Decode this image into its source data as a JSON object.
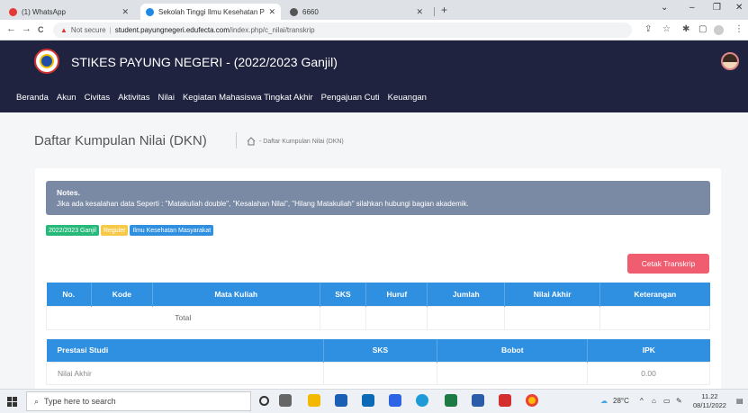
{
  "browser": {
    "tabs": [
      {
        "title": "(1) WhatsApp",
        "color": "#e53935"
      },
      {
        "title": "Sekolah Tinggi Ilmu Kesehatan P",
        "color": "#1e88e5"
      },
      {
        "title": "6660",
        "color": "#555555"
      }
    ],
    "new_tab": "+",
    "nav": {
      "back": "←",
      "forward": "→",
      "reload": "C"
    },
    "url": {
      "warning": "▲",
      "not_secure": "Not secure",
      "sep": "|",
      "host": "student.payungnegeri.edufecta.com",
      "path": "/index.php/c_nilai/transkrip"
    },
    "window": {
      "dropdown": "⌄",
      "minimize": "–",
      "restore": "❐",
      "close": "✕"
    }
  },
  "site": {
    "title": "STIKES PAYUNG NEGERI - (2022/2023 Ganjil)",
    "menu": [
      "Beranda",
      "Akun",
      "Civitas",
      "Aktivitas",
      "Nilai",
      "Kegiatan Mahasiswa Tingkat Akhir",
      "Pengajuan Cuti",
      "Keuangan"
    ]
  },
  "page": {
    "title": "Daftar Kumpulan Nilai (DKN)",
    "breadcrumb": "- Daftar Kumpulan Nilai (DKN)"
  },
  "notes": {
    "title": "Notes.",
    "message": "Jika ada kesalahan data Seperti : \"Matakuliah double\", \"Kesalahan Nilai\", \"Hilang Matakuliah\" silahkan hubungi bagian akademik."
  },
  "badges": [
    {
      "label": "2022/2023 Ganjil",
      "color": "#27b97a"
    },
    {
      "label": "Reguler",
      "color": "#f7c948"
    },
    {
      "label": "Ilmu Kesehatan Masyarakat",
      "color": "#2f8fe0"
    }
  ],
  "print_button": "Cetak Transkrip",
  "transcript_table": {
    "headers": [
      "No.",
      "Kode",
      "Mata Kuliah",
      "SKS",
      "Huruf",
      "Jumlah",
      "Nilai Akhir",
      "Keterangan"
    ],
    "total_label": "Total"
  },
  "summary_table": {
    "headers": [
      "Prestasi Studi",
      "SKS",
      "Bobot",
      "IPK"
    ],
    "row": {
      "label": "Nilai Akhir",
      "ipk": "0.00"
    }
  },
  "taskbar": {
    "search_placeholder": "Type here to search",
    "weather": "28°C",
    "time": "11.22",
    "date": "08/11/2022"
  }
}
